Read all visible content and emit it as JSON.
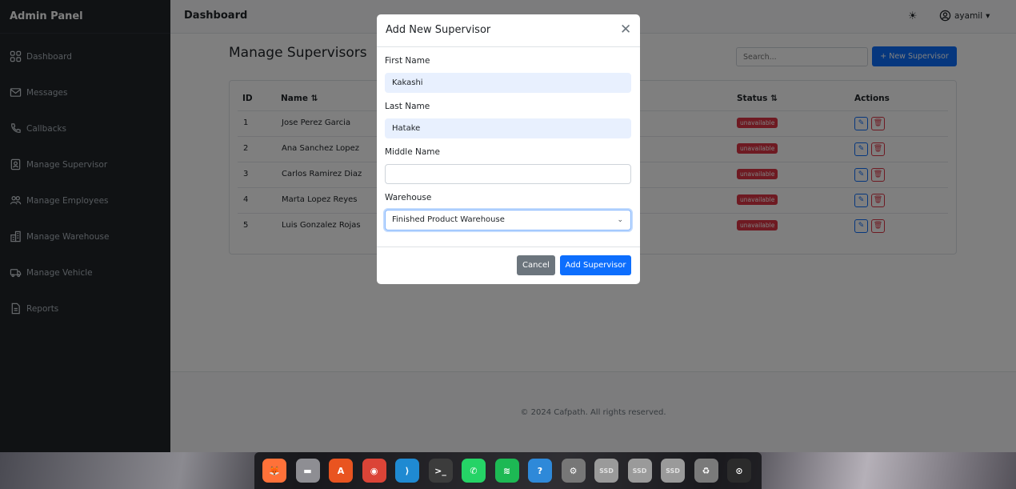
{
  "sidebar": {
    "title": "Admin Panel",
    "items": [
      {
        "label": "Dashboard",
        "icon": "grid-icon"
      },
      {
        "label": "Messages",
        "icon": "envelope-icon"
      },
      {
        "label": "Callbacks",
        "icon": "phone-icon"
      },
      {
        "label": "Manage Supervisor",
        "icon": "person-badge-icon"
      },
      {
        "label": "Manage Employees",
        "icon": "people-icon"
      },
      {
        "label": "Manage Warehouse",
        "icon": "building-icon"
      },
      {
        "label": "Manage Vehicle",
        "icon": "truck-icon"
      },
      {
        "label": "Reports",
        "icon": "file-icon"
      }
    ]
  },
  "topbar": {
    "title": "Dashboard",
    "theme_icon": "☀",
    "user": "ayamil",
    "caret": "▾"
  },
  "page": {
    "title": "Manage Supervisors",
    "search_placeholder": "Search...",
    "new_button": "+ New Supervisor"
  },
  "table": {
    "headers": {
      "id": "ID",
      "name": "Name ⇅",
      "status": "Status ⇅",
      "actions": "Actions"
    },
    "rows": [
      {
        "id": "1",
        "name": "Jose Perez Garcia",
        "status": "unavailable"
      },
      {
        "id": "2",
        "name": "Ana Sanchez Lopez",
        "status": "unavailable"
      },
      {
        "id": "3",
        "name": "Carlos Ramirez Diaz",
        "status": "unavailable"
      },
      {
        "id": "4",
        "name": "Marta Lopez Reyes",
        "status": "unavailable"
      },
      {
        "id": "5",
        "name": "Luis Gonzalez Rojas",
        "status": "unavailable"
      }
    ],
    "edit_glyph": "✎",
    "delete_glyph": "🗑"
  },
  "footer": {
    "text": "© 2024 Cafpath. All rights reserved."
  },
  "modal": {
    "title": "Add New Supervisor",
    "close_glyph": "✕",
    "first_name_label": "First Name",
    "first_name_value": "Kakashi",
    "last_name_label": "Last Name",
    "last_name_value": "Hatake",
    "middle_name_label": "Middle Name",
    "middle_name_value": "",
    "warehouse_label": "Warehouse",
    "warehouse_value": "Finished Product Warehouse",
    "chevron": "⌄",
    "cancel_label": "Cancel",
    "submit_label": "Add Supervisor"
  },
  "dock": {
    "apps": [
      {
        "name": "firefox",
        "glyph": "🦊",
        "color": "#ff7139"
      },
      {
        "name": "files",
        "glyph": "▬",
        "color": "#8e8e93"
      },
      {
        "name": "app-center",
        "glyph": "A",
        "color": "#e95420"
      },
      {
        "name": "chrome",
        "glyph": "◉",
        "color": "#db4437"
      },
      {
        "name": "vscode",
        "glyph": "⟩",
        "color": "#1f8ad2"
      },
      {
        "name": "terminal",
        "glyph": ">_",
        "color": "#3c3c3c"
      },
      {
        "name": "whatsapp",
        "glyph": "✆",
        "color": "#25d366"
      },
      {
        "name": "spotify",
        "glyph": "≋",
        "color": "#1db954"
      },
      {
        "name": "help",
        "glyph": "?",
        "color": "#2e89d9"
      },
      {
        "name": "settings",
        "glyph": "⚙",
        "color": "#777777"
      },
      {
        "name": "ssd-drive-1",
        "glyph": "SSD",
        "color": "#9a9a9a"
      },
      {
        "name": "ssd-drive-2",
        "glyph": "SSD",
        "color": "#9a9a9a"
      },
      {
        "name": "ssd-drive-3",
        "glyph": "SSD",
        "color": "#9a9a9a"
      },
      {
        "name": "trash",
        "glyph": "♻",
        "color": "#7a7a7a"
      },
      {
        "name": "show-apps",
        "glyph": "⊙",
        "color": "#2b2b2b"
      }
    ]
  }
}
